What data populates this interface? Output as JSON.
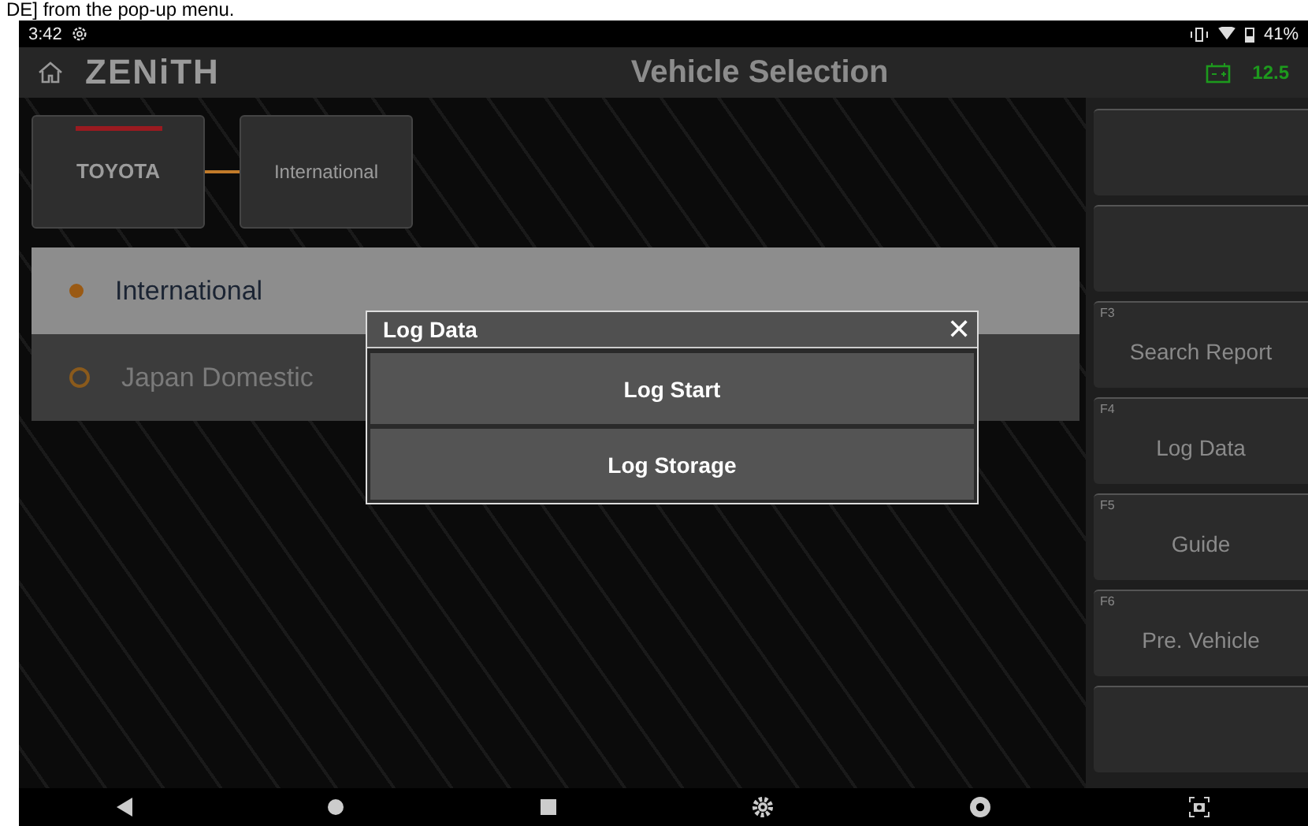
{
  "caption": "DE] from the pop-up menu.",
  "status_bar": {
    "time": "3:42",
    "battery": "41%"
  },
  "header": {
    "logo": "ZENiTH",
    "title": "Vehicle Selection",
    "voltage": "12.5"
  },
  "breadcrumb": [
    {
      "label": "TOYOTA",
      "kind": "brand"
    },
    {
      "label": "International",
      "kind": "region"
    }
  ],
  "regions": [
    {
      "label": "International",
      "selected": true
    },
    {
      "label": "Japan Domestic",
      "selected": false
    }
  ],
  "function_keys": [
    {
      "kind": "blank"
    },
    {
      "kind": "blank"
    },
    {
      "kind": "key",
      "key": "F3",
      "label": "Search Report"
    },
    {
      "kind": "key",
      "key": "F4",
      "label": "Log Data"
    },
    {
      "kind": "key",
      "key": "F5",
      "label": "Guide"
    },
    {
      "kind": "key",
      "key": "F6",
      "label": "Pre. Vehicle"
    },
    {
      "kind": "blank"
    }
  ],
  "dialog": {
    "title": "Log Data",
    "close": "✕",
    "buttons": [
      "Log Start",
      "Log Storage"
    ]
  }
}
